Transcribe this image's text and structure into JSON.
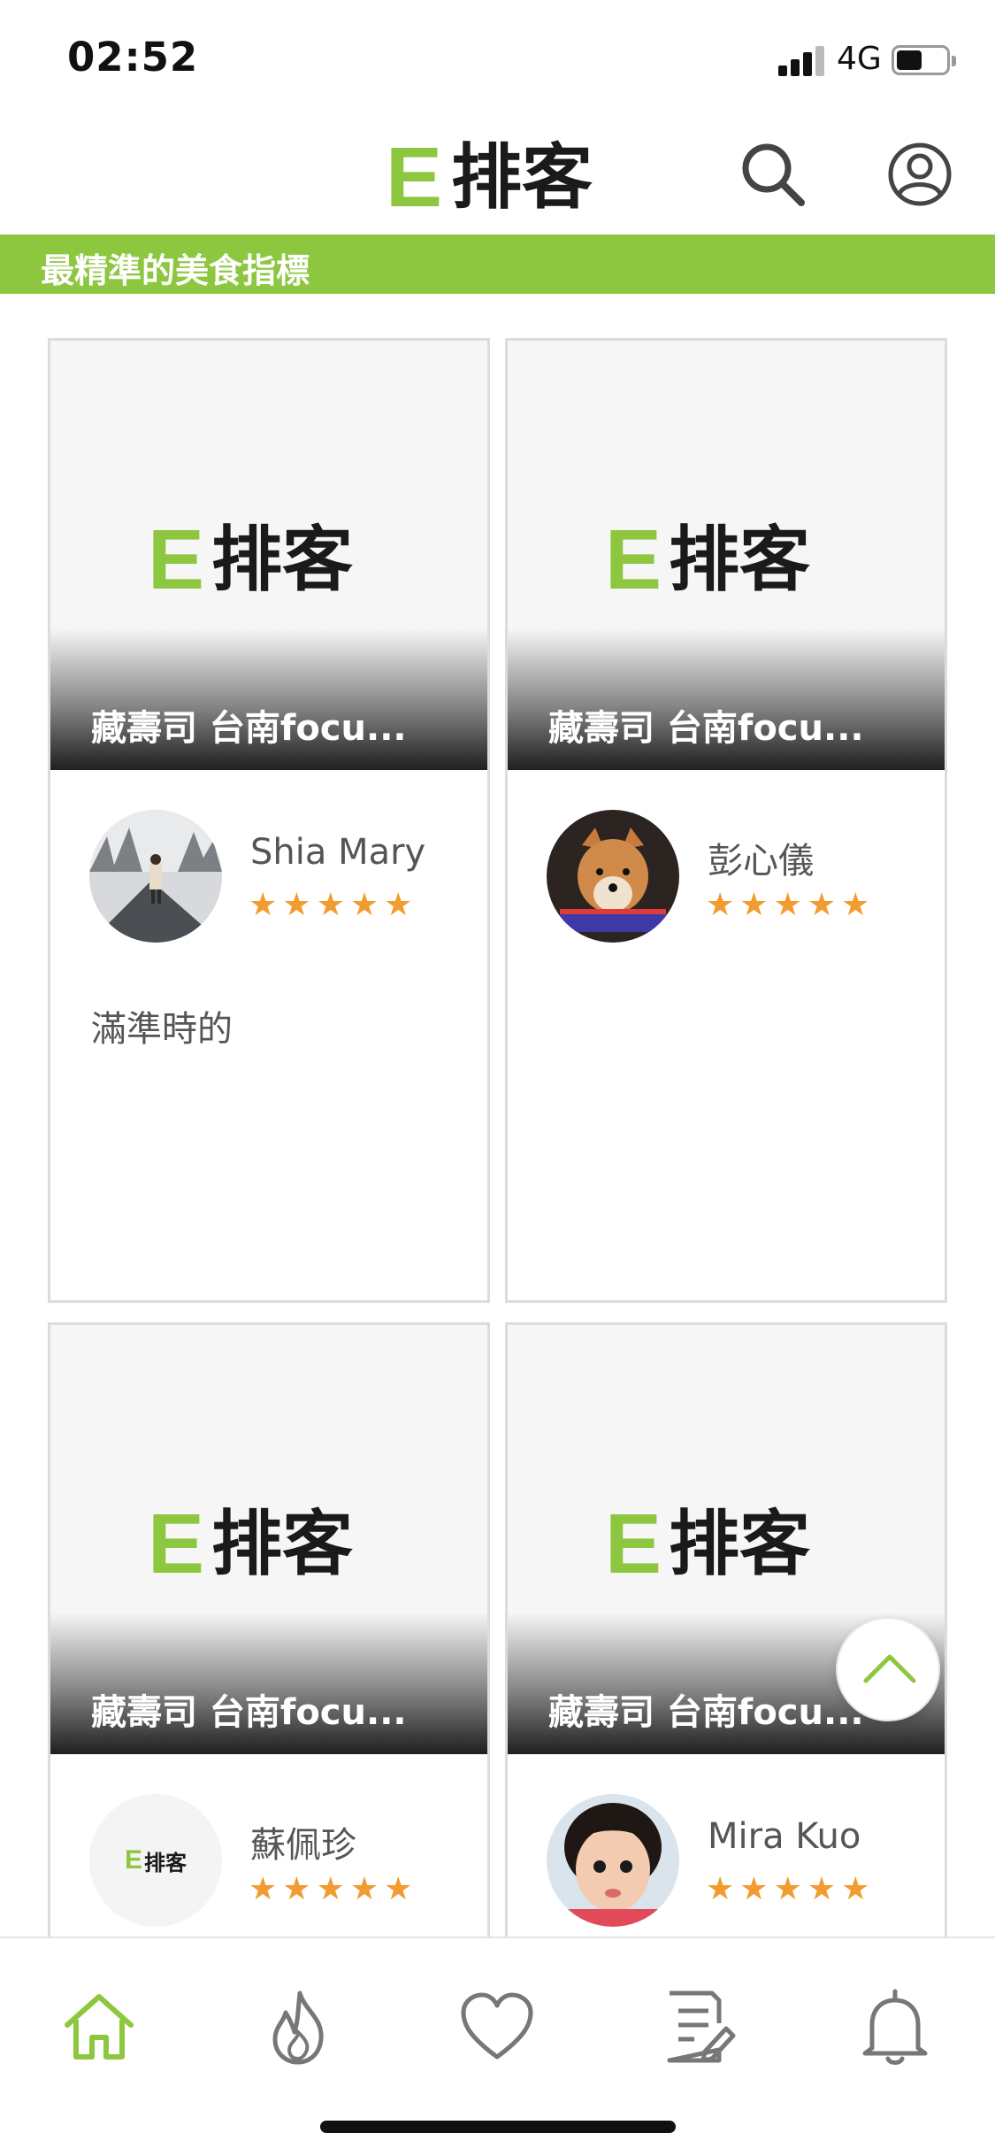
{
  "status_bar": {
    "time": "02:52",
    "network": "4G"
  },
  "header": {
    "logo_mark": "E",
    "logo_text": "排客",
    "icons": [
      "search-icon",
      "profile-icon"
    ]
  },
  "tagline": "最精準的美食指標",
  "feed": {
    "cards": [
      {
        "banner_logo_mark": "E",
        "banner_logo_text": "排客",
        "title": "藏壽司 台南focu...",
        "user": "Shia Mary",
        "rating": 5,
        "comment": "滿準時的"
      },
      {
        "banner_logo_mark": "E",
        "banner_logo_text": "排客",
        "title": "藏壽司 台南focu...",
        "user": "彭心儀",
        "rating": 5,
        "comment": ""
      },
      {
        "banner_logo_mark": "E",
        "banner_logo_text": "排客",
        "title": "藏壽司 台南focu...",
        "user": "蘇佩珍",
        "rating": 5,
        "comment": ""
      },
      {
        "banner_logo_mark": "E",
        "banner_logo_text": "排客",
        "title": "藏壽司 台南focu...",
        "user": "Mira Kuo",
        "rating": 5,
        "comment": ""
      }
    ],
    "avatar_logo_mark": "E",
    "avatar_logo_text": "排客"
  },
  "tab_bar": {
    "items": [
      "home-icon",
      "fire-icon",
      "heart-icon",
      "review-icon",
      "bell-icon"
    ],
    "active": "home-icon"
  },
  "colors": {
    "brand_green": "#8dc63f",
    "star": "#f29b30",
    "text": "#555555"
  }
}
